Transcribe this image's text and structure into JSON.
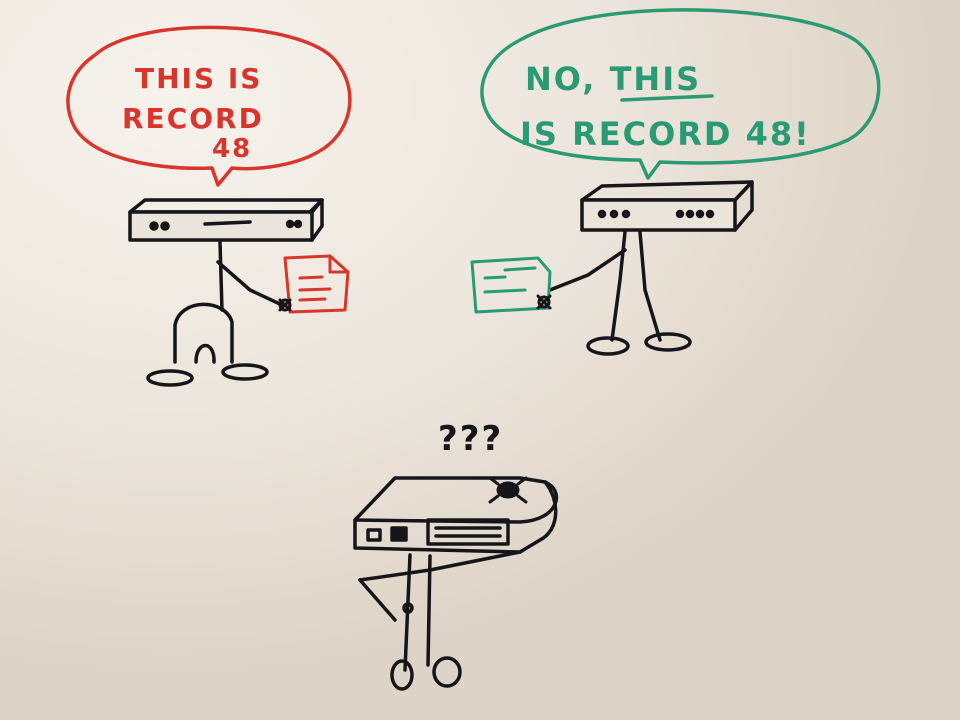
{
  "board": {
    "background": "#ede6dc",
    "marker_colors": {
      "red": "#d8362c",
      "green": "#2a9a74",
      "black": "#15151a"
    }
  },
  "bubbles": {
    "left": {
      "line1": "THIS IS",
      "line2": "RECORD",
      "line3": "48"
    },
    "right": {
      "line1_prefix": "NO, ",
      "line1_emphasis": "THIS",
      "line2": "IS RECORD 48!"
    }
  },
  "confused": {
    "text": "???"
  },
  "icons": {
    "left_device": "server-icon",
    "right_device": "server-icon",
    "center_device": "server-icon",
    "bug": "bug-icon",
    "left_document": "document-icon",
    "right_document": "document-icon"
  }
}
